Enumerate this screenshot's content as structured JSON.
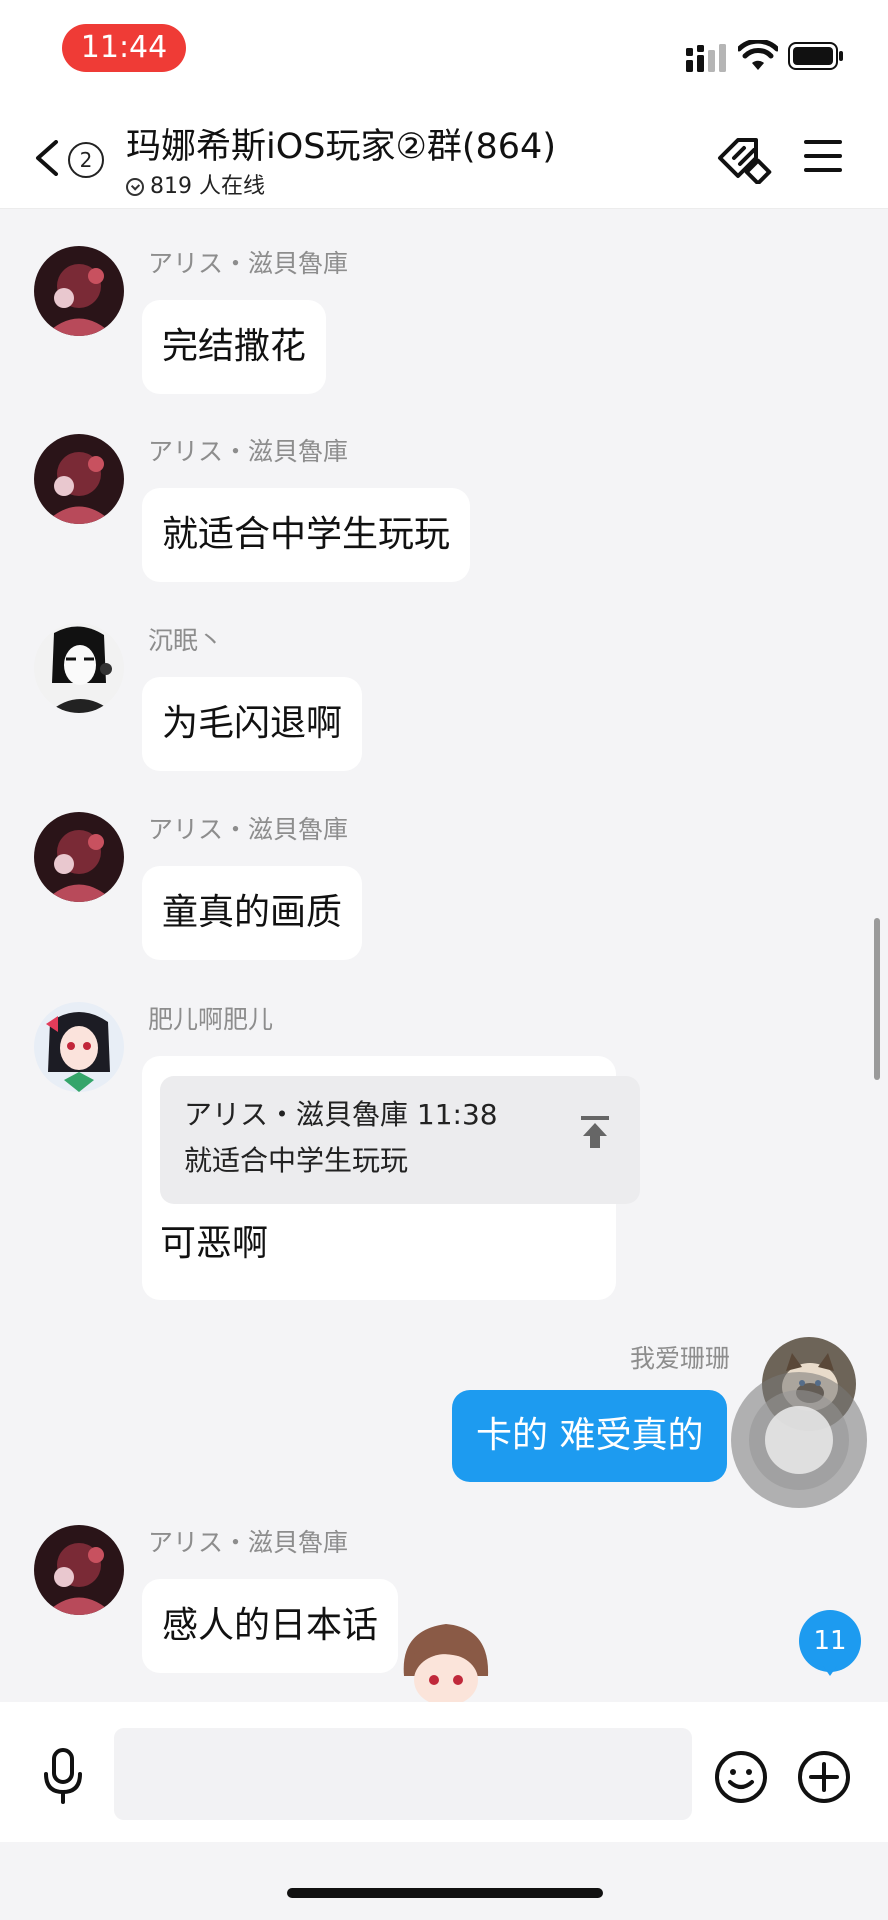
{
  "status_bar": {
    "time": "11:44"
  },
  "header": {
    "back_count": "2",
    "title": "玛娜希斯iOS玩家②群(864)",
    "online": "819 人在线"
  },
  "messages": [
    {
      "sender": "アリス・滋貝魯庫",
      "text": "完结撒花"
    },
    {
      "sender": "アリス・滋貝魯庫",
      "text": "就适合中学生玩玩"
    },
    {
      "sender": "沉眠丶",
      "text": "为毛闪退啊"
    },
    {
      "sender": "アリス・滋貝魯庫",
      "text": "童真的画质"
    },
    {
      "sender": "肥儿啊肥儿",
      "quote_head": "アリス・滋貝魯庫 11:38",
      "quote_text": "就适合中学生玩玩",
      "text": "可恶啊"
    },
    {
      "sender": "アリス・滋貝魯庫",
      "text": "感人的日本话"
    }
  ],
  "my_message": {
    "sender": "我爱珊珊",
    "text": "卡的 难受真的"
  },
  "unread_count": "11",
  "colors": {
    "accent": "#1d9bf0",
    "time_pill": "#ef3b36",
    "chat_bg": "#f4f4f6"
  },
  "icons": [
    "signal-icon",
    "wifi-icon",
    "battery-icon",
    "back-chevron-icon",
    "group-tag-icon",
    "menu-icon",
    "mic-icon",
    "emoji-icon",
    "plus-icon",
    "jump-to-quote-icon"
  ]
}
